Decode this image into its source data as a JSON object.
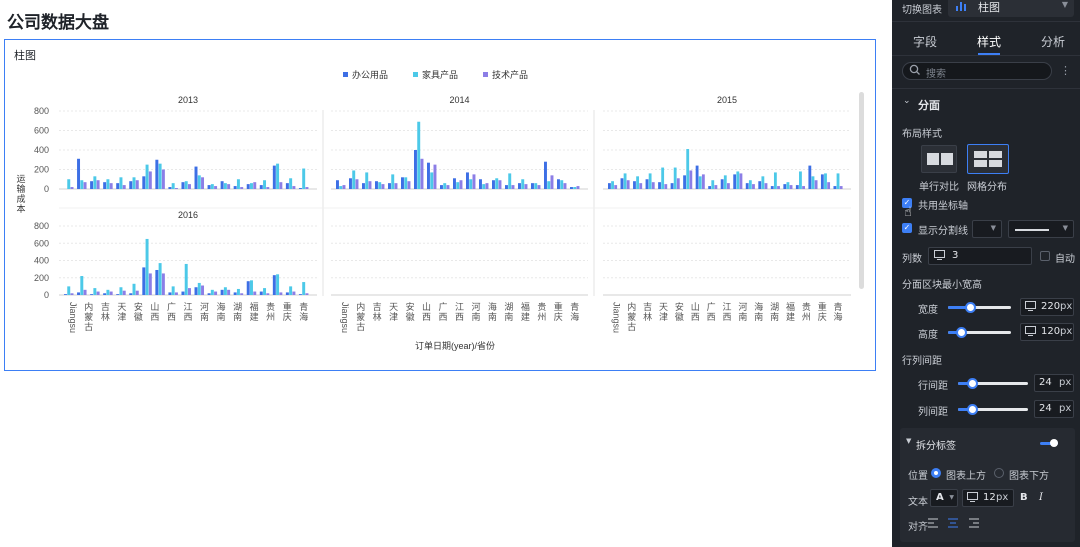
{
  "page": {
    "title": "公司数据大盘"
  },
  "card": {
    "title": "柱图"
  },
  "legend": [
    {
      "label": "办公用品",
      "color": "#3d6fe5"
    },
    {
      "label": "家具产品",
      "color": "#4cc9e8"
    },
    {
      "label": "技术产品",
      "color": "#8c7ee6"
    }
  ],
  "chart_data": {
    "type": "bar",
    "facets": [
      {
        "label": "2013",
        "series": {
          "办公用品": [
            0,
            310,
            80,
            70,
            60,
            80,
            130,
            300,
            20,
            70,
            230,
            40,
            80,
            30,
            50,
            40,
            240,
            60,
            10
          ],
          "家具产品": [
            100,
            90,
            130,
            100,
            120,
            120,
            250,
            260,
            60,
            80,
            140,
            50,
            60,
            100,
            60,
            90,
            260,
            110,
            210
          ],
          "技术产品": [
            20,
            70,
            90,
            60,
            40,
            90,
            180,
            200,
            10,
            50,
            120,
            30,
            50,
            20,
            70,
            20,
            70,
            30,
            20
          ]
        }
      },
      {
        "label": "2014",
        "series": {
          "办公用品": [
            90,
            110,
            60,
            80,
            60,
            120,
            400,
            270,
            40,
            110,
            170,
            100,
            90,
            40,
            60,
            60,
            280,
            100,
            20
          ],
          "家具产品": [
            30,
            190,
            170,
            70,
            150,
            120,
            690,
            170,
            60,
            70,
            100,
            50,
            110,
            160,
            100,
            60,
            80,
            90,
            20
          ],
          "技术产品": [
            40,
            100,
            80,
            50,
            60,
            80,
            310,
            250,
            40,
            90,
            150,
            60,
            90,
            40,
            50,
            40,
            140,
            60,
            30
          ]
        }
      },
      {
        "label": "2015",
        "series": {
          "办公用品": [
            60,
            110,
            80,
            100,
            70,
            60,
            140,
            240,
            30,
            100,
            150,
            60,
            80,
            30,
            50,
            40,
            240,
            150,
            30
          ],
          "家具产品": [
            80,
            160,
            130,
            160,
            220,
            220,
            410,
            130,
            90,
            140,
            180,
            90,
            130,
            170,
            70,
            180,
            130,
            160,
            160
          ],
          "技术产品": [
            40,
            90,
            60,
            70,
            50,
            110,
            190,
            150,
            40,
            60,
            160,
            50,
            60,
            30,
            40,
            30,
            90,
            70,
            30
          ]
        }
      },
      {
        "label": "2016",
        "series": {
          "办公用品": [
            10,
            30,
            10,
            20,
            10,
            20,
            320,
            290,
            30,
            40,
            90,
            20,
            60,
            30,
            160,
            40,
            230,
            30,
            10
          ],
          "家具产品": [
            100,
            220,
            80,
            60,
            90,
            130,
            650,
            370,
            100,
            360,
            140,
            60,
            90,
            70,
            170,
            80,
            240,
            100,
            150
          ],
          "技术产品": [
            20,
            60,
            40,
            40,
            50,
            50,
            250,
            250,
            30,
            80,
            110,
            40,
            60,
            20,
            40,
            20,
            30,
            40,
            20
          ]
        }
      }
    ],
    "categories": [
      "Jiangsu",
      "内蒙古",
      "吉林",
      "天津",
      "安徽",
      "山西",
      "广西",
      "江西",
      "河南",
      "海南",
      "湖南",
      "福建",
      "贵州",
      "重庆",
      "青海"
    ],
    "ylim": [
      0,
      800
    ],
    "yticks": [
      800,
      600,
      400,
      200,
      0
    ],
    "ylabel": "运输成本",
    "xlabel": "订单日期(year)/省份",
    "columns": 3,
    "grid": true,
    "legend_position": "top"
  },
  "panel": {
    "switch_label": "切换图表",
    "chart_type": "柱图",
    "tabs": [
      "字段",
      "样式",
      "分析"
    ],
    "search_placeholder": "搜索",
    "section_title": "分面",
    "layout_style_label": "布局样式",
    "layout_options": [
      "单行对比",
      "网格分布"
    ],
    "shared_axis_label": "共用坐标轴",
    "show_divider_label": "显示分割线",
    "columns_label": "列数",
    "columns_value": "3",
    "auto_label": "自动",
    "min_size_label": "分面区块最小宽高",
    "width_label": "宽度",
    "width_value": "220",
    "height_label": "高度",
    "height_value": "120",
    "unit_px": "px",
    "row_col_gap_label": "行列间距",
    "row_gap_label": "行间距",
    "row_gap_value": "24",
    "col_gap_label": "列间距",
    "col_gap_value": "24",
    "split_label_title": "拆分标签",
    "position_label": "位置",
    "position_options": [
      "图表上方",
      "图表下方"
    ],
    "text_label": "文本",
    "font_letter": "A",
    "font_size_value": "12",
    "bold_label": "B",
    "italic_label": "I",
    "align_label": "对齐",
    "width_slider": 0.35,
    "height_slider": 0.2,
    "row_gap_slider": 0.2,
    "col_gap_slider": 0.2
  }
}
